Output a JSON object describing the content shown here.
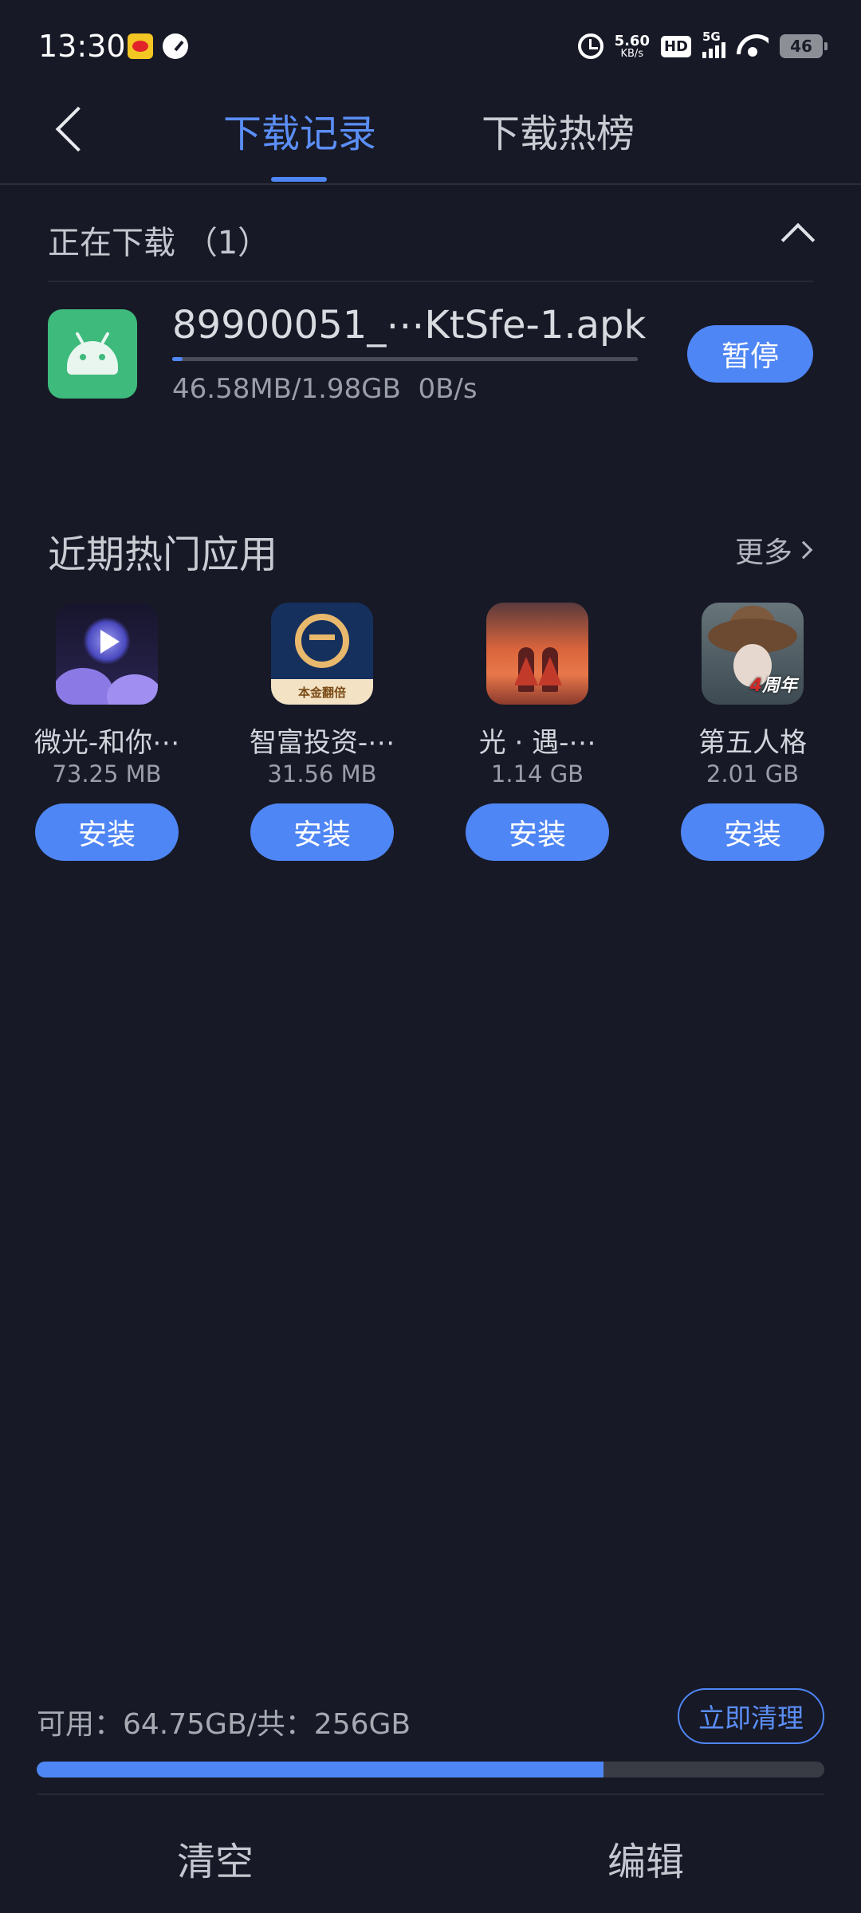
{
  "status_bar": {
    "time": "13:30",
    "net_speed_value": "5.60",
    "net_speed_unit": "KB/s",
    "hd_label": "HD",
    "network_type": "5G",
    "battery_level": "46",
    "icons": [
      "weibo-icon",
      "gauge-icon",
      "alarm-icon",
      "hd-icon",
      "signal-icon",
      "wifi-icon",
      "battery-icon"
    ]
  },
  "header": {
    "tabs": [
      {
        "label": "下载记录",
        "active": true
      },
      {
        "label": "下载热榜",
        "active": false
      }
    ]
  },
  "downloading": {
    "section_title": "正在下载 （1）",
    "item": {
      "file_name": "89900051_⋯KtSfe-1.apk",
      "meta": "46.58MB/1.98GB  0B/s",
      "progress_fraction": 0.023,
      "action_label": "暂停"
    }
  },
  "hot_apps": {
    "title": "近期热门应用",
    "more_label": "更多",
    "install_label": "安装",
    "items": [
      {
        "name": "微光-和你⋯",
        "size": "73.25 MB"
      },
      {
        "name": "智富投资-⋯",
        "size": "31.56 MB",
        "icon_text": "本金翻倍"
      },
      {
        "name": "光 · 遇-⋯",
        "size": "1.14 GB"
      },
      {
        "name": "第五人格",
        "size": "2.01 GB",
        "icon_text_number": "4",
        "icon_text": "周年"
      }
    ]
  },
  "storage": {
    "text": "可用：64.75GB/共：256GB",
    "clean_label": "立即清理",
    "used_fraction": 0.72
  },
  "footer": {
    "clear_label": "清空",
    "edit_label": "编辑"
  },
  "colors": {
    "background": "#171926",
    "accent": "#4f86f5"
  }
}
